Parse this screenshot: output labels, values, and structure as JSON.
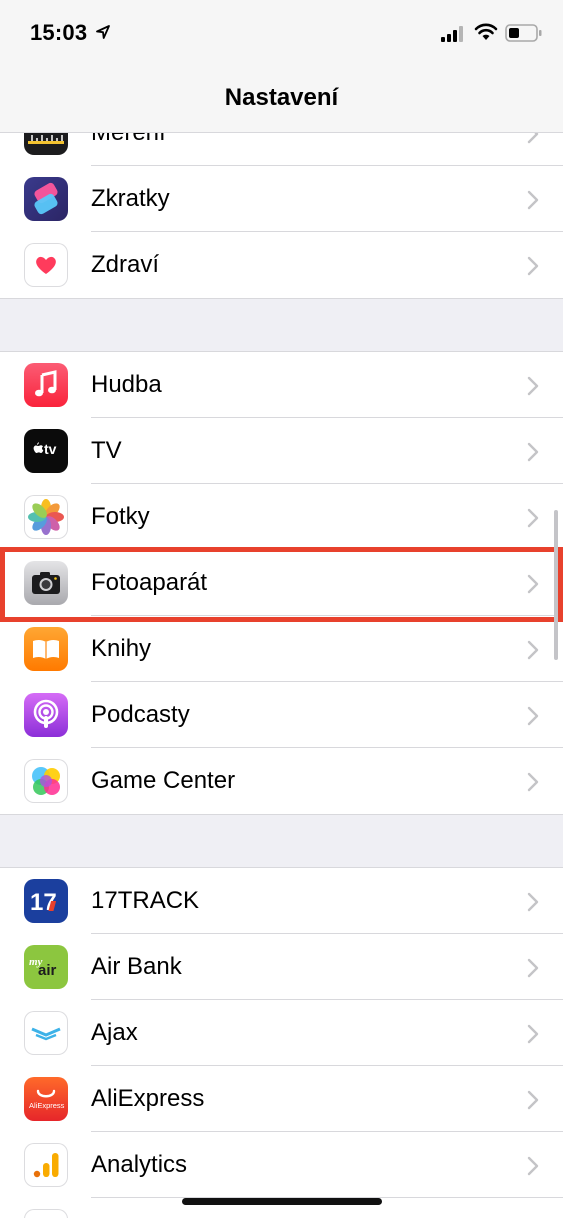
{
  "status_bar": {
    "time": "15:03"
  },
  "nav": {
    "title": "Nastavení"
  },
  "groups": [
    {
      "items": [
        {
          "label": "Měření",
          "icon": "measure-icon"
        },
        {
          "label": "Zkratky",
          "icon": "shortcuts-icon"
        },
        {
          "label": "Zdraví",
          "icon": "health-icon"
        }
      ]
    },
    {
      "items": [
        {
          "label": "Hudba",
          "icon": "music-icon"
        },
        {
          "label": "TV",
          "icon": "tv-icon"
        },
        {
          "label": "Fotky",
          "icon": "photos-icon"
        },
        {
          "label": "Fotoaparát",
          "icon": "camera-icon"
        },
        {
          "label": "Knihy",
          "icon": "books-icon"
        },
        {
          "label": "Podcasty",
          "icon": "podcasts-icon"
        },
        {
          "label": "Game Center",
          "icon": "game-center-icon"
        }
      ]
    },
    {
      "items": [
        {
          "label": "17TRACK",
          "icon": "17track-icon",
          "icon_text": "17"
        },
        {
          "label": "Air Bank",
          "icon": "air-bank-icon",
          "icon_text": "air",
          "icon_text_small": "my"
        },
        {
          "label": "Ajax",
          "icon": "ajax-icon"
        },
        {
          "label": "AliExpress",
          "icon": "aliexpress-icon",
          "icon_text": "AliExpress"
        },
        {
          "label": "Analytics",
          "icon": "analytics-icon"
        }
      ]
    }
  ],
  "highlighted_item": "Fotoaparát"
}
